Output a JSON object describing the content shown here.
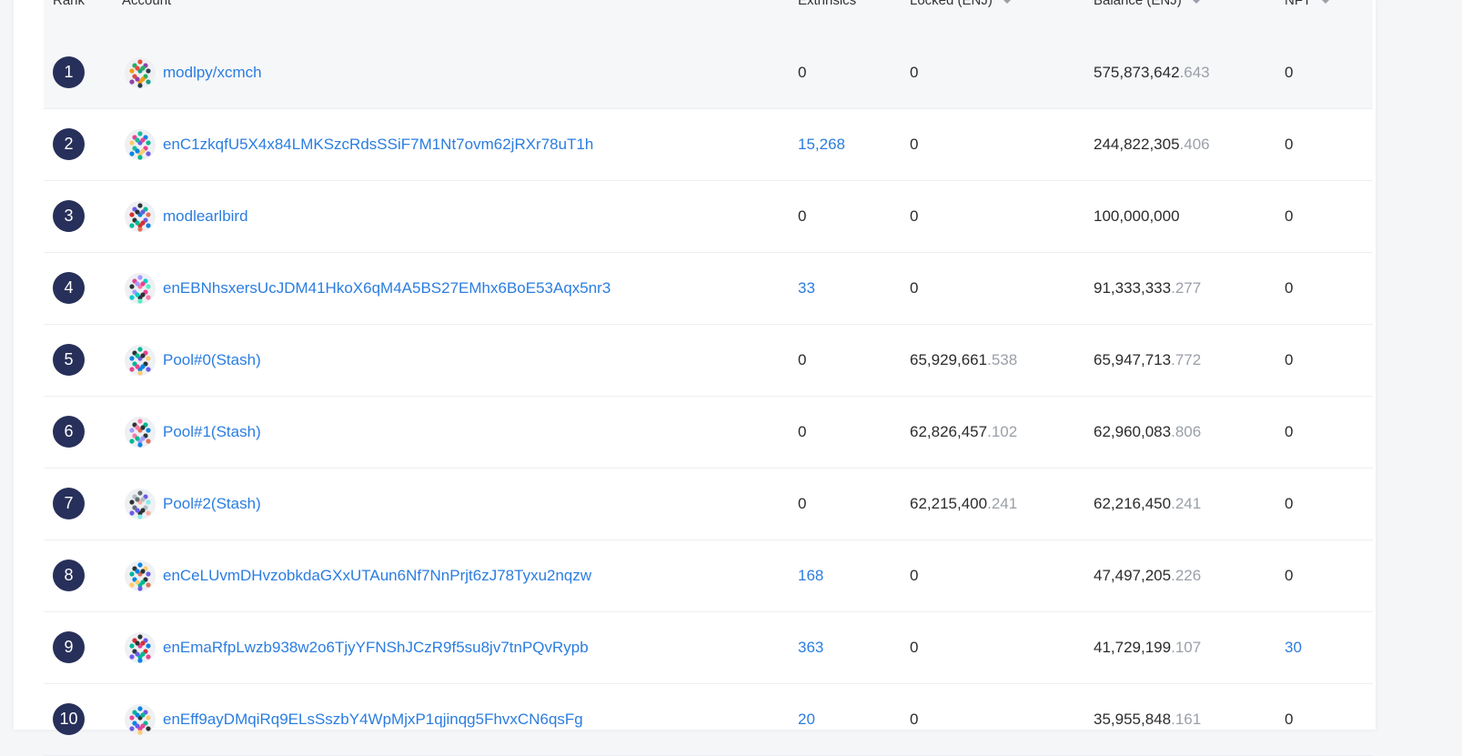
{
  "headers": {
    "rank": "Rank",
    "account": "Account",
    "extrinsics": "Extrinsics",
    "locked": "Locked (ENJ)",
    "balance": "Balance (ENJ)",
    "nft": "NFT"
  },
  "rows": [
    {
      "rank": "1",
      "account": "modlpy/xcmch",
      "extrinsics": "0",
      "extrinsics_link": false,
      "locked_int": "0",
      "locked_dec": "",
      "balance_int": "575,873,642",
      "balance_dec": ".643",
      "nft": "0",
      "nft_link": false
    },
    {
      "rank": "2",
      "account": "enC1zkqfU5X4x84LMKSzcRdsSSiF7M1Nt7ovm62jRXr78uT1h",
      "extrinsics": "15,268",
      "extrinsics_link": true,
      "locked_int": "0",
      "locked_dec": "",
      "balance_int": "244,822,305",
      "balance_dec": ".406",
      "nft": "0",
      "nft_link": false
    },
    {
      "rank": "3",
      "account": "modlearlbird",
      "extrinsics": "0",
      "extrinsics_link": false,
      "locked_int": "0",
      "locked_dec": "",
      "balance_int": "100,000,000",
      "balance_dec": "",
      "nft": "0",
      "nft_link": false
    },
    {
      "rank": "4",
      "account": "enEBNhsxersUcJDM41HkoX6qM4A5BS27EMhx6BoE53Aqx5nr3",
      "extrinsics": "33",
      "extrinsics_link": true,
      "locked_int": "0",
      "locked_dec": "",
      "balance_int": "91,333,333",
      "balance_dec": ".277",
      "nft": "0",
      "nft_link": false
    },
    {
      "rank": "5",
      "account": "Pool#0(Stash)",
      "extrinsics": "0",
      "extrinsics_link": false,
      "locked_int": "65,929,661",
      "locked_dec": ".538",
      "balance_int": "65,947,713",
      "balance_dec": ".772",
      "nft": "0",
      "nft_link": false
    },
    {
      "rank": "6",
      "account": "Pool#1(Stash)",
      "extrinsics": "0",
      "extrinsics_link": false,
      "locked_int": "62,826,457",
      "locked_dec": ".102",
      "balance_int": "62,960,083",
      "balance_dec": ".806",
      "nft": "0",
      "nft_link": false
    },
    {
      "rank": "7",
      "account": "Pool#2(Stash)",
      "extrinsics": "0",
      "extrinsics_link": false,
      "locked_int": "62,215,400",
      "locked_dec": ".241",
      "balance_int": "62,216,450",
      "balance_dec": ".241",
      "nft": "0",
      "nft_link": false
    },
    {
      "rank": "8",
      "account": "enCeLUvmDHvzobkdaGXxUTAun6Nf7NnPrjt6zJ78Tyxu2nqzw",
      "extrinsics": "168",
      "extrinsics_link": true,
      "locked_int": "0",
      "locked_dec": "",
      "balance_int": "47,497,205",
      "balance_dec": ".226",
      "nft": "0",
      "nft_link": false
    },
    {
      "rank": "9",
      "account": "enEmaRfpLwzb938w2o6TjyYFNShJCzR9f5su8jv7tnPQvRypb",
      "extrinsics": "363",
      "extrinsics_link": true,
      "locked_int": "0",
      "locked_dec": "",
      "balance_int": "41,729,199",
      "balance_dec": ".107",
      "nft": "30",
      "nft_link": true
    },
    {
      "rank": "10",
      "account": "enEff9ayDMqiRq9ELsSszbY4WpMjxP1qjinqg5FhvxCN6qsFg",
      "extrinsics": "20",
      "extrinsics_link": true,
      "locked_int": "0",
      "locked_dec": "",
      "balance_int": "35,955,848",
      "balance_dec": ".161",
      "nft": "0",
      "nft_link": false
    }
  ]
}
